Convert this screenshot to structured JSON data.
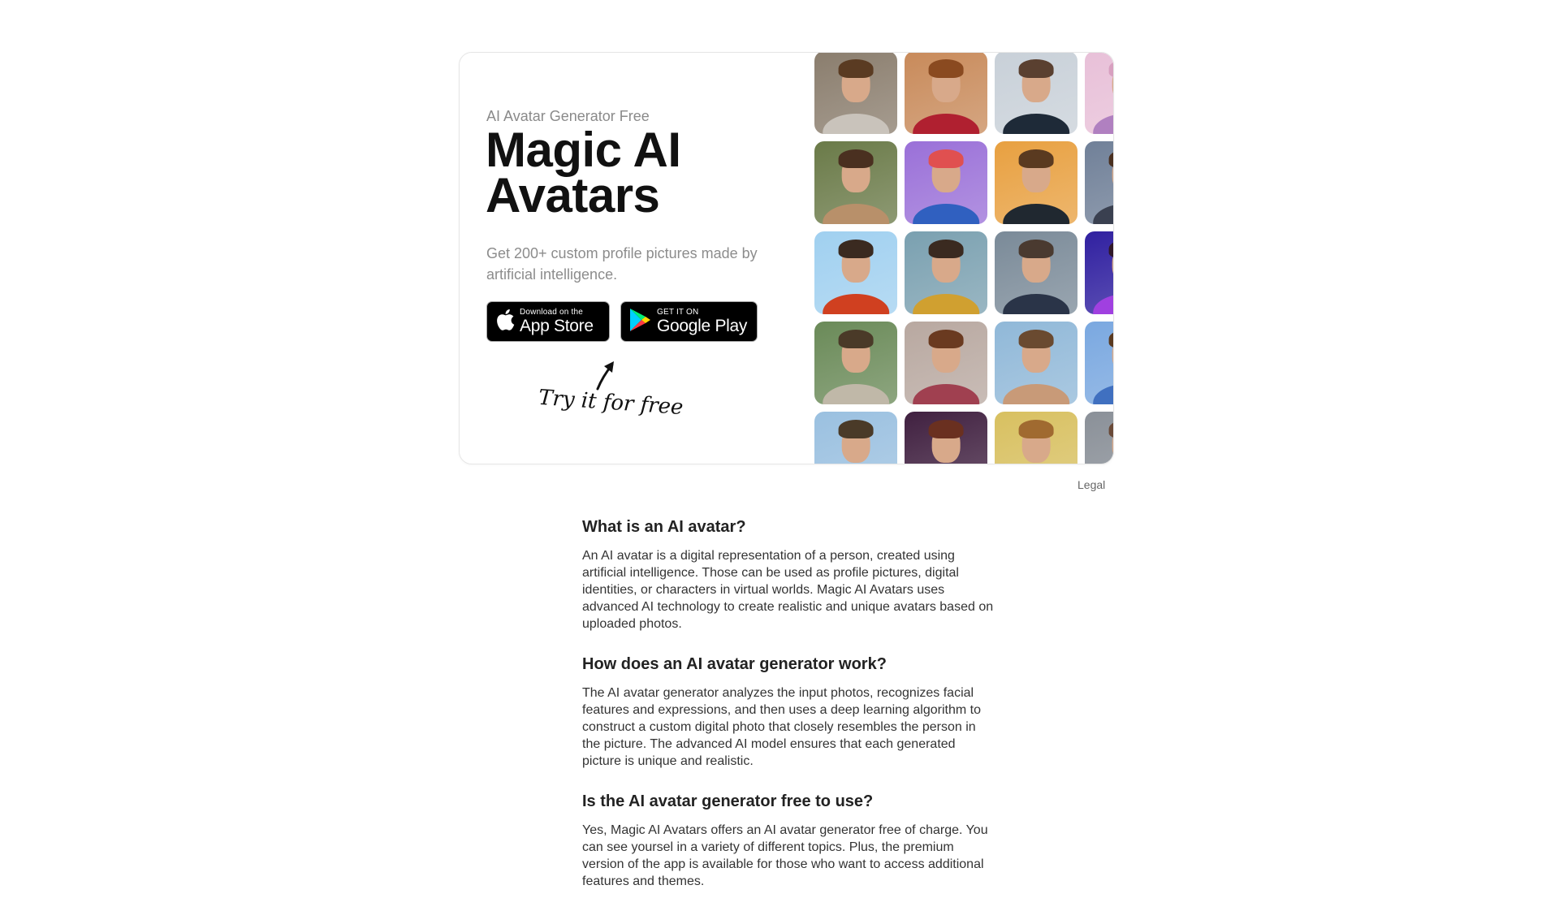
{
  "hero": {
    "eyebrow": "AI Avatar Generator Free",
    "title": "Magic AI Avatars",
    "subtitle": "Get 200+ custom profile pictures made by artificial intelligence.",
    "appstore": {
      "small": "Download on the",
      "big": "App Store"
    },
    "googleplay": {
      "small": "GET IT ON",
      "big": "Google Play"
    },
    "try_free": "Try it for free"
  },
  "avatars": [
    {
      "name": "avatar-knight-man",
      "bg": "#8a7d6d",
      "shirt": "#c9c3bb",
      "hair": "#5a3b22"
    },
    {
      "name": "avatar-smiling-woman",
      "bg": "#c88a5a",
      "shirt": "#b02030",
      "hair": "#8a4a20"
    },
    {
      "name": "avatar-sunglasses-man",
      "bg": "#c8d0d8",
      "shirt": "#1e2a38",
      "hair": "#5a4030"
    },
    {
      "name": "avatar-pink-woman",
      "bg": "#e8c0d8",
      "shirt": "#b080c0",
      "hair": "#d8a0c0"
    },
    {
      "name": "avatar-jungle-man",
      "bg": "#6a7a48",
      "shirt": "#b8906a",
      "hair": "#4a3020"
    },
    {
      "name": "avatar-rainbow-woman",
      "bg": "#9a70d8",
      "shirt": "#3060c0",
      "hair": "#e05050"
    },
    {
      "name": "avatar-orange-man",
      "bg": "#e8a040",
      "shirt": "#202830",
      "hair": "#5a3a20"
    },
    {
      "name": "avatar-city-woman",
      "bg": "#708098",
      "shirt": "#3a4050",
      "hair": "#4a3020"
    },
    {
      "name": "avatar-sky-man",
      "bg": "#a0d0f0",
      "shirt": "#d04020",
      "hair": "#3a2a20"
    },
    {
      "name": "avatar-curly-woman",
      "bg": "#7aa0b0",
      "shirt": "#d0a030",
      "hair": "#3a2a20"
    },
    {
      "name": "avatar-suit-man",
      "bg": "#7a8a98",
      "shirt": "#2a3448",
      "hair": "#4a3a30"
    },
    {
      "name": "avatar-neon-woman",
      "bg": "#3020a0",
      "shirt": "#a040e0",
      "hair": "#301828"
    },
    {
      "name": "avatar-forest-man",
      "bg": "#6a8a58",
      "shirt": "#c0b8a8",
      "hair": "#4a3a28"
    },
    {
      "name": "avatar-portrait-woman",
      "bg": "#b8a8a0",
      "shirt": "#a04050",
      "hair": "#6a3a20"
    },
    {
      "name": "avatar-beach-man",
      "bg": "#90b8d8",
      "shirt": "#c89a78",
      "hair": "#6a4a30"
    },
    {
      "name": "avatar-blue-woman",
      "bg": "#7aa8e0",
      "shirt": "#4070c0",
      "hair": "#5a3a20"
    },
    {
      "name": "avatar-blue-suit-man",
      "bg": "#9ac0e0",
      "shirt": "#6a98b8",
      "hair": "#4a3a28"
    },
    {
      "name": "avatar-neon-portrait-woman",
      "bg": "#402040",
      "shirt": "#d04070",
      "hair": "#6a3020"
    },
    {
      "name": "avatar-golden-man",
      "bg": "#d8c060",
      "shirt": "#3060a0",
      "hair": "#a06a30"
    },
    {
      "name": "avatar-grey-woman",
      "bg": "#8a9098",
      "shirt": "#506070",
      "hair": "#6a4a38"
    }
  ],
  "legal": "Legal",
  "faq": [
    {
      "question": "What is an AI avatar?",
      "answer": "An AI avatar is a digital representation of a person, created using artificial intelligence. Those can be used as profile pictures, digital identities, or characters in virtual worlds. Magic AI Avatars uses advanced AI technology to create realistic and unique avatars based on uploaded photos."
    },
    {
      "question": "How does an AI avatar generator work?",
      "answer": "The AI avatar generator analyzes the input photos, recognizes facial features and expressions, and then uses a deep learning algorithm to construct a custom digital photo that closely resembles the person in the picture. The advanced AI model ensures that each generated picture is unique and realistic."
    },
    {
      "question": "Is the AI avatar generator free to use?",
      "answer": "Yes, Magic AI Avatars offers an AI avatar generator free of charge. You can see yoursel in a variety of different topics. Plus, the premium version of the app is available for those who want to access additional features and themes."
    }
  ]
}
